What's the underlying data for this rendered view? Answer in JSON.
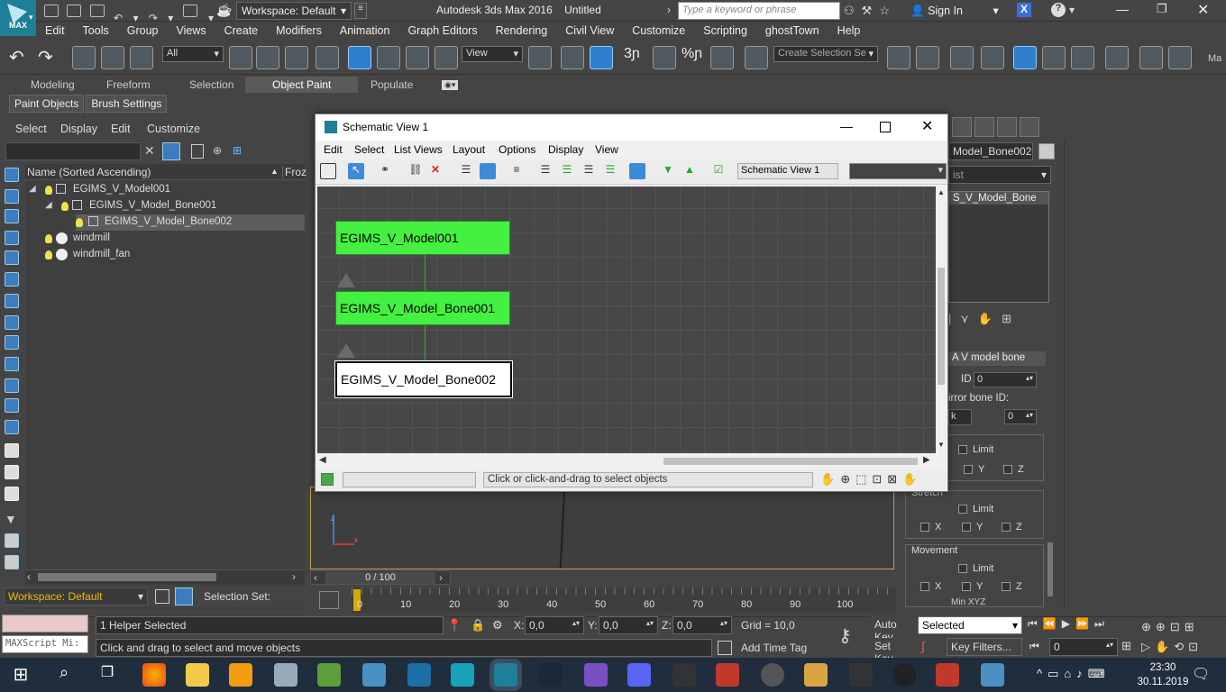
{
  "app": {
    "logo_text": "MAX",
    "title": "Autodesk 3ds Max 2016",
    "document": "Untitled",
    "workspace": "Workspace: Default",
    "search_placeholder": "Type a keyword or phrase",
    "sign_in": "Sign In"
  },
  "menu": [
    "Edit",
    "Tools",
    "Group",
    "Views",
    "Create",
    "Modifiers",
    "Animation",
    "Graph Editors",
    "Rendering",
    "Civil View",
    "Customize",
    "Scripting",
    "ghostTown",
    "Help"
  ],
  "toolbar": {
    "selection_filter": "All",
    "ref_coord": "View",
    "snap_labels": [
      "3",
      "%"
    ],
    "selection_set_placeholder": "Create Selection Se",
    "far_label": "Ma"
  },
  "ribbon": {
    "tabs": [
      "Modeling",
      "Freeform",
      "Selection",
      "Object Paint",
      "Populate"
    ],
    "active_tab": "Object Paint",
    "sub_buttons": [
      "Paint Objects",
      "Brush Settings"
    ]
  },
  "scene_explorer": {
    "menu": [
      "Select",
      "Display",
      "Edit",
      "Customize"
    ],
    "column_name": "Name (Sorted Ascending)",
    "column_frozen": "Froz",
    "rows": [
      {
        "name": "EGIMS_V_Model001",
        "level": 0,
        "selected": false
      },
      {
        "name": "EGIMS_V_Model_Bone001",
        "level": 1,
        "selected": false
      },
      {
        "name": "EGIMS_V_Model_Bone002",
        "level": 2,
        "selected": true
      },
      {
        "name": "windmill",
        "level": 0,
        "selected": false
      },
      {
        "name": "windmill_fan",
        "level": 0,
        "selected": false
      }
    ],
    "workspace_bottom": "Workspace: Default",
    "selection_set_label": "Selection Set:"
  },
  "schematic": {
    "title": "Schematic View 1",
    "menu": [
      "Edit",
      "Select",
      "List Views",
      "Layout",
      "Options",
      "Display",
      "View"
    ],
    "name_field": "Schematic View 1",
    "nodes": [
      {
        "label": "EGIMS_V_Model001",
        "style": "green"
      },
      {
        "label": "EGIMS_V_Model_Bone001",
        "style": "green"
      },
      {
        "label": "EGIMS_V_Model_Bone002",
        "style": "white"
      }
    ],
    "status_text": "Click or click-and-drag to select objects"
  },
  "command_panel": {
    "object_name": "Model_Bone002",
    "list_label": "ist",
    "list_item": "S_V_Model_Bone",
    "rollout_title": "A V model bone",
    "id_label": "ID",
    "id_value": "0",
    "mirror_label": "irror bone ID:",
    "mirror_value": "0",
    "k_label": "k",
    "limit_label": "Limit",
    "axis_x": "X",
    "axis_y": "Y",
    "axis_z": "Z",
    "stretch_label": "Stretch",
    "movement_label": "Movement",
    "min_label": "Min XYZ"
  },
  "timeline": {
    "frame": "0 / 100",
    "ticks": [
      "0",
      "10",
      "20",
      "30",
      "40",
      "50",
      "60",
      "70",
      "80",
      "90",
      "100"
    ]
  },
  "status": {
    "maxscript": "MAXScript Mi:",
    "selected_count": "1 Helper Selected",
    "prompt": "Click and drag to select and move objects",
    "x_label": "X:",
    "x": "0,0",
    "y_label": "Y:",
    "y": "0,0",
    "z_label": "Z:",
    "z": "0,0",
    "grid": "Grid = 10,0",
    "add_time_tag": "Add Time Tag",
    "auto_key": "Auto Key",
    "set_key": "Set Key",
    "key_mode": "Selected",
    "key_filters": "Key Filters...",
    "current_frame": "0"
  },
  "taskbar": {
    "time": "23:30",
    "date": "30.11.2019"
  },
  "colors": {
    "node_green": "#44f040",
    "accent_blue": "#2f7fcf",
    "viewport_border": "#caa245"
  }
}
